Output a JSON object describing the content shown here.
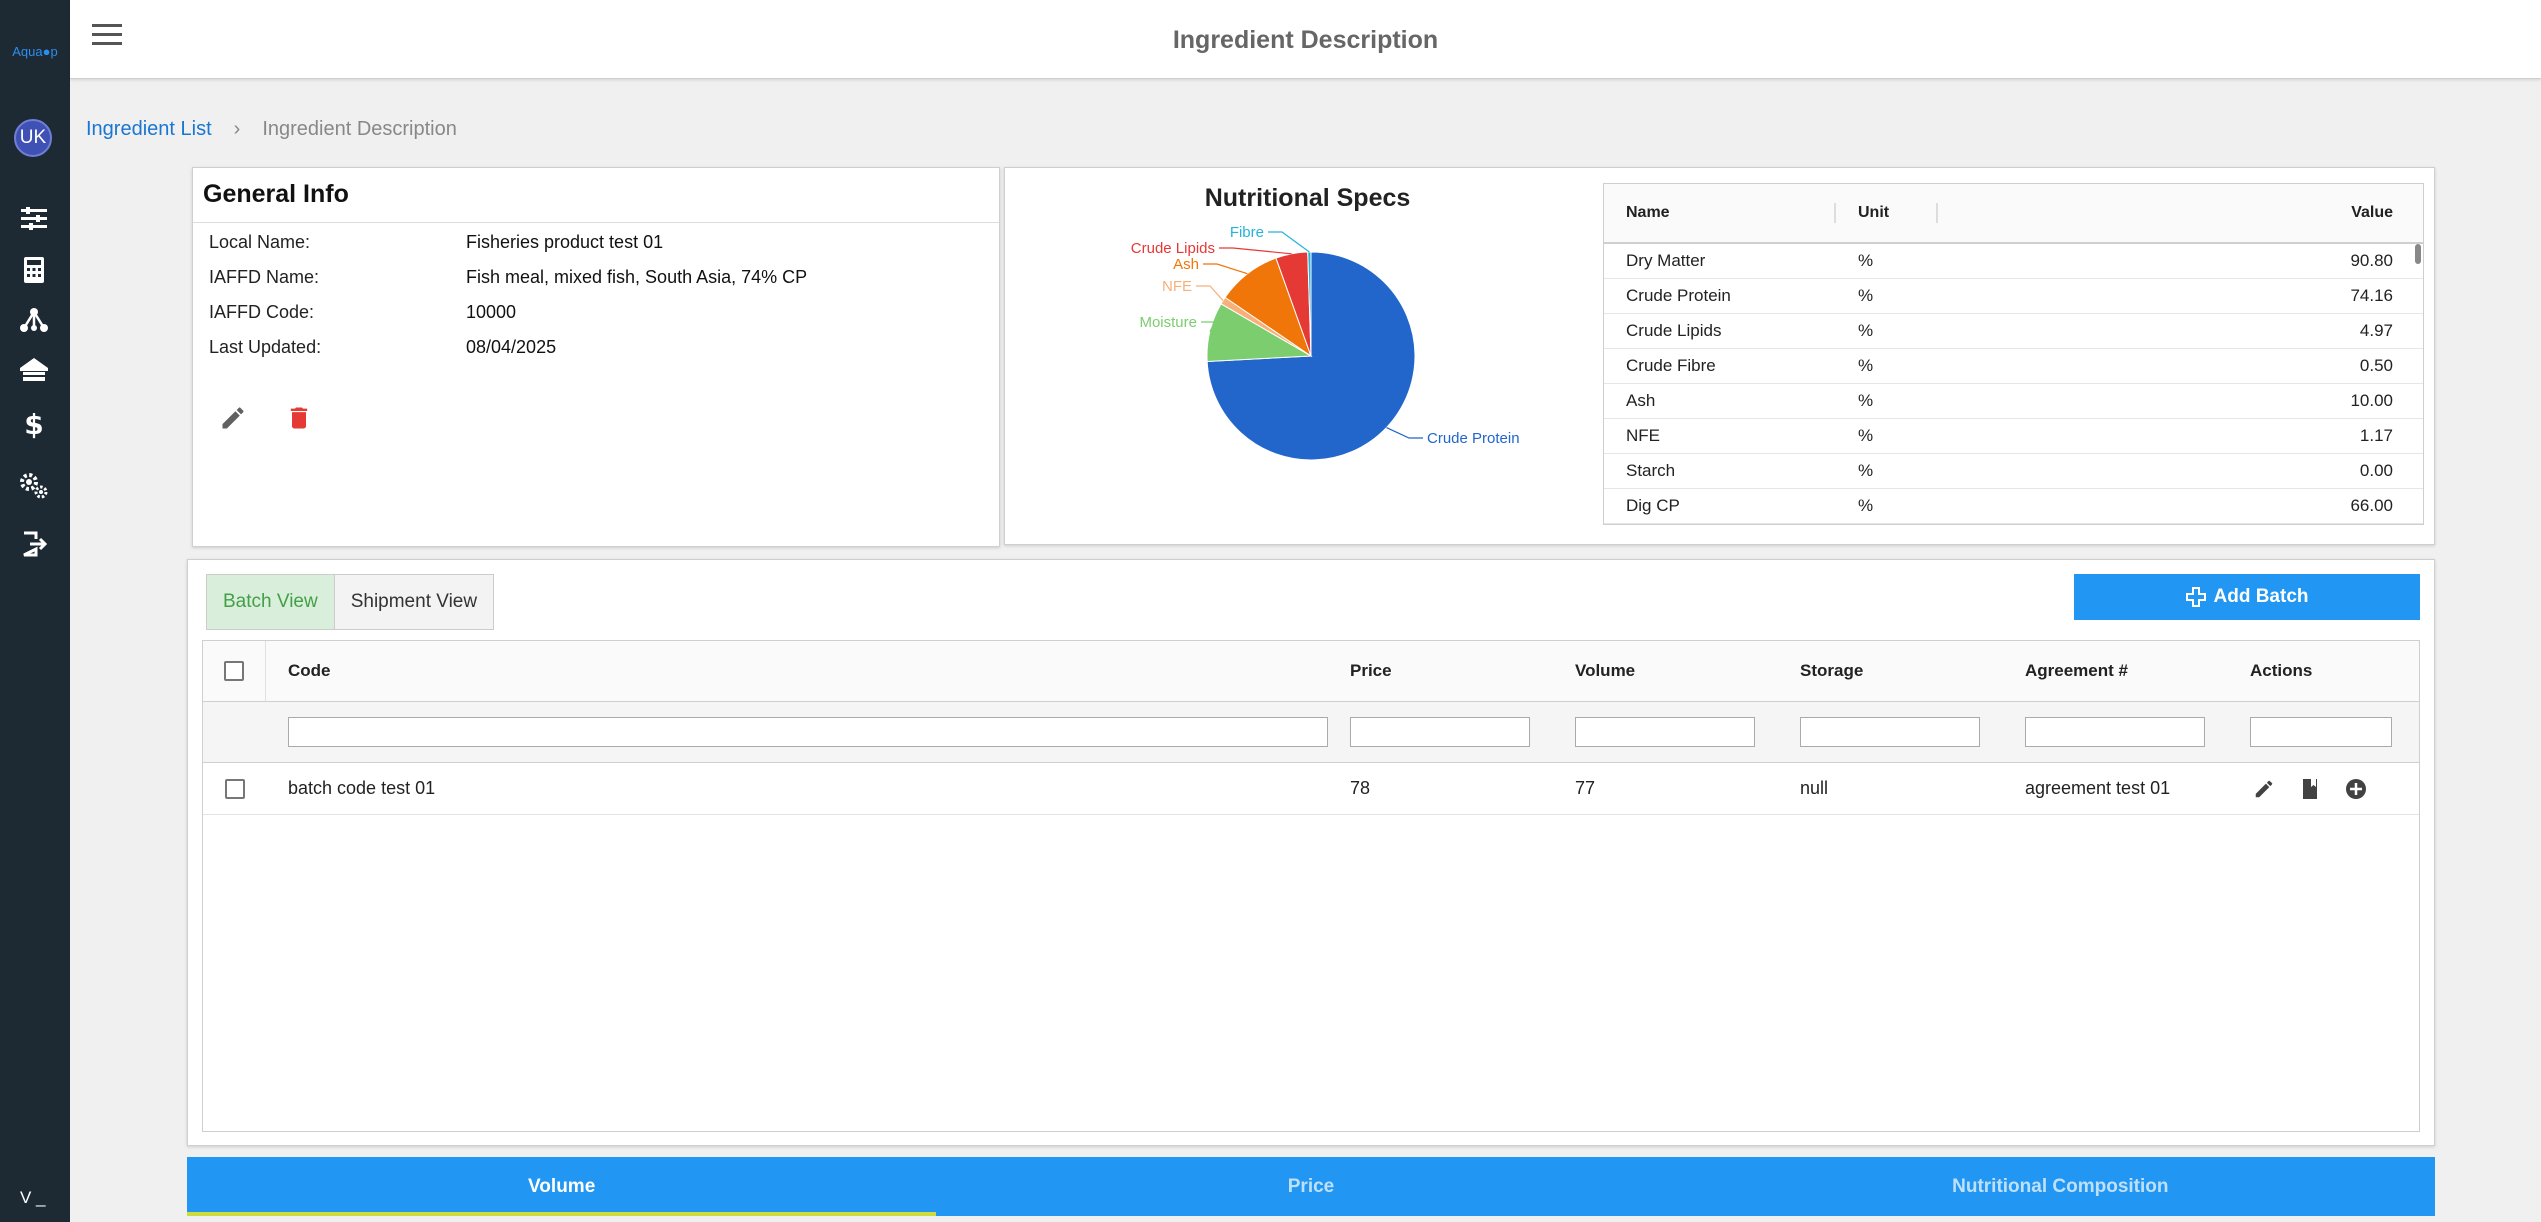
{
  "app": {
    "logo_text": "Aqua●p",
    "avatar_initials": "UK",
    "version": "V _"
  },
  "header": {
    "title": "Ingredient Description"
  },
  "breadcrumb": {
    "parent": "Ingredient List",
    "separator": "›",
    "current": "Ingredient Description"
  },
  "general_info": {
    "title": "General Info",
    "rows": [
      {
        "label": "Local Name:",
        "value": "Fisheries product test 01"
      },
      {
        "label": "IAFFD Name:",
        "value": "Fish meal, mixed fish, South Asia, 74% CP"
      },
      {
        "label": "IAFFD Code:",
        "value": "10000"
      },
      {
        "label": "Last Updated:",
        "value": "08/04/2025"
      }
    ]
  },
  "nutrition": {
    "title": "Nutritional Specs",
    "table_headers": {
      "name": "Name",
      "unit": "Unit",
      "value": "Value"
    },
    "rows": [
      {
        "name": "Dry Matter",
        "unit": "%",
        "value": "90.80"
      },
      {
        "name": "Crude Protein",
        "unit": "%",
        "value": "74.16"
      },
      {
        "name": "Crude Lipids",
        "unit": "%",
        "value": "4.97"
      },
      {
        "name": "Crude Fibre",
        "unit": "%",
        "value": "0.50"
      },
      {
        "name": "Ash",
        "unit": "%",
        "value": "10.00"
      },
      {
        "name": "NFE",
        "unit": "%",
        "value": "1.17"
      },
      {
        "name": "Starch",
        "unit": "%",
        "value": "0.00"
      },
      {
        "name": "Dig CP",
        "unit": "%",
        "value": "66.00"
      }
    ]
  },
  "chart_data": {
    "type": "pie",
    "title": "Nutritional Specs",
    "categories": [
      "Crude Protein",
      "Moisture",
      "NFE",
      "Ash",
      "Crude Lipids",
      "Fibre"
    ],
    "values": [
      74.16,
      9.2,
      1.17,
      10.0,
      4.97,
      0.5
    ],
    "colors": [
      "#2266cc",
      "#7ccd6e",
      "#f7b07a",
      "#f0760a",
      "#e53935",
      "#26b4d6"
    ]
  },
  "batch": {
    "tabs": [
      "Batch View",
      "Shipment View"
    ],
    "add_label": "Add Batch",
    "columns": {
      "code": "Code",
      "price": "Price",
      "volume": "Volume",
      "storage": "Storage",
      "agreement": "Agreement #",
      "actions": "Actions"
    },
    "rows": [
      {
        "code": "batch code test 01",
        "price": "78",
        "volume": "77",
        "storage": "null",
        "agreement": "agreement test 01"
      }
    ]
  },
  "bottom_tabs": [
    "Volume",
    "Price",
    "Nutritional Composition"
  ]
}
